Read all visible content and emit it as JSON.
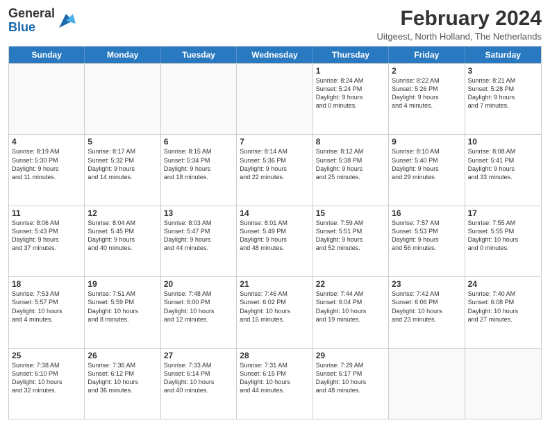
{
  "logo": {
    "general": "General",
    "blue": "Blue"
  },
  "title": "February 2024",
  "location": "Uitgeest, North Holland, The Netherlands",
  "header_days": [
    "Sunday",
    "Monday",
    "Tuesday",
    "Wednesday",
    "Thursday",
    "Friday",
    "Saturday"
  ],
  "weeks": [
    [
      {
        "day": "",
        "info": ""
      },
      {
        "day": "",
        "info": ""
      },
      {
        "day": "",
        "info": ""
      },
      {
        "day": "",
        "info": ""
      },
      {
        "day": "1",
        "info": "Sunrise: 8:24 AM\nSunset: 5:24 PM\nDaylight: 9 hours\nand 0 minutes."
      },
      {
        "day": "2",
        "info": "Sunrise: 8:22 AM\nSunset: 5:26 PM\nDaylight: 9 hours\nand 4 minutes."
      },
      {
        "day": "3",
        "info": "Sunrise: 8:21 AM\nSunset: 5:28 PM\nDaylight: 9 hours\nand 7 minutes."
      }
    ],
    [
      {
        "day": "4",
        "info": "Sunrise: 8:19 AM\nSunset: 5:30 PM\nDaylight: 9 hours\nand 11 minutes."
      },
      {
        "day": "5",
        "info": "Sunrise: 8:17 AM\nSunset: 5:32 PM\nDaylight: 9 hours\nand 14 minutes."
      },
      {
        "day": "6",
        "info": "Sunrise: 8:15 AM\nSunset: 5:34 PM\nDaylight: 9 hours\nand 18 minutes."
      },
      {
        "day": "7",
        "info": "Sunrise: 8:14 AM\nSunset: 5:36 PM\nDaylight: 9 hours\nand 22 minutes."
      },
      {
        "day": "8",
        "info": "Sunrise: 8:12 AM\nSunset: 5:38 PM\nDaylight: 9 hours\nand 25 minutes."
      },
      {
        "day": "9",
        "info": "Sunrise: 8:10 AM\nSunset: 5:40 PM\nDaylight: 9 hours\nand 29 minutes."
      },
      {
        "day": "10",
        "info": "Sunrise: 8:08 AM\nSunset: 5:41 PM\nDaylight: 9 hours\nand 33 minutes."
      }
    ],
    [
      {
        "day": "11",
        "info": "Sunrise: 8:06 AM\nSunset: 5:43 PM\nDaylight: 9 hours\nand 37 minutes."
      },
      {
        "day": "12",
        "info": "Sunrise: 8:04 AM\nSunset: 5:45 PM\nDaylight: 9 hours\nand 40 minutes."
      },
      {
        "day": "13",
        "info": "Sunrise: 8:03 AM\nSunset: 5:47 PM\nDaylight: 9 hours\nand 44 minutes."
      },
      {
        "day": "14",
        "info": "Sunrise: 8:01 AM\nSunset: 5:49 PM\nDaylight: 9 hours\nand 48 minutes."
      },
      {
        "day": "15",
        "info": "Sunrise: 7:59 AM\nSunset: 5:51 PM\nDaylight: 9 hours\nand 52 minutes."
      },
      {
        "day": "16",
        "info": "Sunrise: 7:57 AM\nSunset: 5:53 PM\nDaylight: 9 hours\nand 56 minutes."
      },
      {
        "day": "17",
        "info": "Sunrise: 7:55 AM\nSunset: 5:55 PM\nDaylight: 10 hours\nand 0 minutes."
      }
    ],
    [
      {
        "day": "18",
        "info": "Sunrise: 7:53 AM\nSunset: 5:57 PM\nDaylight: 10 hours\nand 4 minutes."
      },
      {
        "day": "19",
        "info": "Sunrise: 7:51 AM\nSunset: 5:59 PM\nDaylight: 10 hours\nand 8 minutes."
      },
      {
        "day": "20",
        "info": "Sunrise: 7:48 AM\nSunset: 6:00 PM\nDaylight: 10 hours\nand 12 minutes."
      },
      {
        "day": "21",
        "info": "Sunrise: 7:46 AM\nSunset: 6:02 PM\nDaylight: 10 hours\nand 15 minutes."
      },
      {
        "day": "22",
        "info": "Sunrise: 7:44 AM\nSunset: 6:04 PM\nDaylight: 10 hours\nand 19 minutes."
      },
      {
        "day": "23",
        "info": "Sunrise: 7:42 AM\nSunset: 6:06 PM\nDaylight: 10 hours\nand 23 minutes."
      },
      {
        "day": "24",
        "info": "Sunrise: 7:40 AM\nSunset: 6:08 PM\nDaylight: 10 hours\nand 27 minutes."
      }
    ],
    [
      {
        "day": "25",
        "info": "Sunrise: 7:38 AM\nSunset: 6:10 PM\nDaylight: 10 hours\nand 32 minutes."
      },
      {
        "day": "26",
        "info": "Sunrise: 7:36 AM\nSunset: 6:12 PM\nDaylight: 10 hours\nand 36 minutes."
      },
      {
        "day": "27",
        "info": "Sunrise: 7:33 AM\nSunset: 6:14 PM\nDaylight: 10 hours\nand 40 minutes."
      },
      {
        "day": "28",
        "info": "Sunrise: 7:31 AM\nSunset: 6:15 PM\nDaylight: 10 hours\nand 44 minutes."
      },
      {
        "day": "29",
        "info": "Sunrise: 7:29 AM\nSunset: 6:17 PM\nDaylight: 10 hours\nand 48 minutes."
      },
      {
        "day": "",
        "info": ""
      },
      {
        "day": "",
        "info": ""
      }
    ]
  ]
}
